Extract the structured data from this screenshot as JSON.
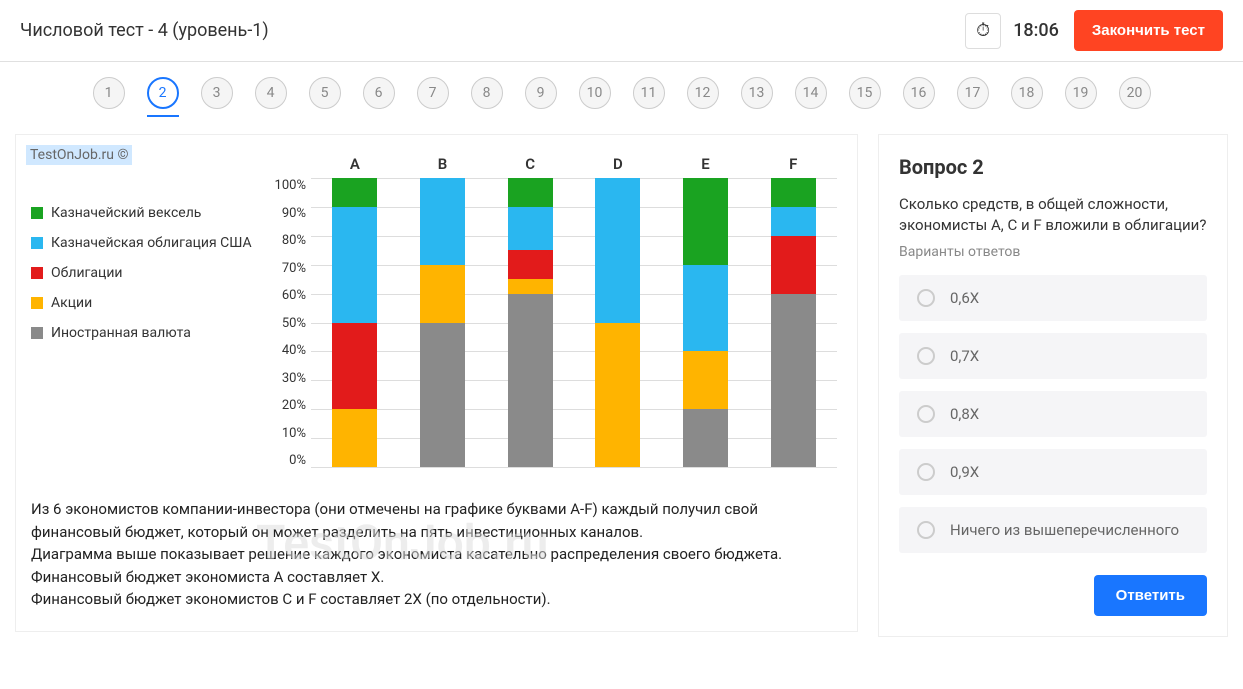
{
  "header": {
    "title": "Числовой тест - 4 (уровень-1)",
    "timer": "18:06",
    "end_button": "Закончить тест"
  },
  "nav": {
    "items": [
      "1",
      "2",
      "3",
      "4",
      "5",
      "6",
      "7",
      "8",
      "9",
      "10",
      "11",
      "12",
      "13",
      "14",
      "15",
      "16",
      "17",
      "18",
      "19",
      "20"
    ],
    "current_index": 1
  },
  "watermark": "TestOnJob.ru ©",
  "watermark_bg": "TestOnJob.ru",
  "chart_data": {
    "type": "bar",
    "stacked": true,
    "categories": [
      "A",
      "B",
      "C",
      "D",
      "E",
      "F"
    ],
    "series": [
      {
        "name": "Иностранная валюта",
        "color": "#8a8a8a",
        "values": [
          0,
          50,
          60,
          0,
          20,
          60
        ]
      },
      {
        "name": "Акции",
        "color": "#ffb400",
        "values": [
          20,
          20,
          5,
          50,
          20,
          0
        ]
      },
      {
        "name": "Облигации",
        "color": "#e21b1b",
        "values": [
          30,
          0,
          10,
          0,
          0,
          20
        ]
      },
      {
        "name": "Казначейская облигация США",
        "color": "#2ab7f0",
        "values": [
          40,
          30,
          15,
          50,
          30,
          10
        ]
      },
      {
        "name": "Казначейский вексель",
        "color": "#1aa321",
        "values": [
          10,
          0,
          10,
          0,
          30,
          10
        ]
      }
    ],
    "ylabel": "",
    "xlabel": "",
    "ylim": [
      0,
      100
    ],
    "yticks": [
      "100%",
      "90%",
      "80%",
      "70%",
      "60%",
      "50%",
      "40%",
      "30%",
      "20%",
      "10%",
      "0%"
    ],
    "legend_order": [
      "Казначейский вексель",
      "Казначейская облигация США",
      "Облигации",
      "Акции",
      "Иностранная валюта"
    ],
    "legend_colors": {
      "Казначейский вексель": "#1aa321",
      "Казначейская облигация США": "#2ab7f0",
      "Облигации": "#e21b1b",
      "Акции": "#ffb400",
      "Иностранная валюта": "#8a8a8a"
    }
  },
  "description": {
    "p1": "Из 6 экономистов компании-инвестора (они отмечены на графике буквами A-F) каждый получил свой финансовый бюджет, который он может разделить на пять инвестиционных каналов.",
    "p2": "Диаграмма выше показывает решение каждого экономиста касательно распределения своего бюджета.",
    "p3": "Финансовый бюджет экономиста А составляет Х.",
    "p4": "Финансовый бюджет экономистов С и F составляет 2Х  (по отдельности)."
  },
  "question": {
    "title": "Вопрос 2",
    "text": "Сколько средств, в общей сложности, экономисты А, С и F вложили в облигации?",
    "subtitle": "Варианты ответов",
    "options": [
      "0,6X",
      "0,7X",
      "0,8X",
      "0,9X",
      "Ничего из вышеперечисленного"
    ],
    "answer_button": "Ответить"
  }
}
